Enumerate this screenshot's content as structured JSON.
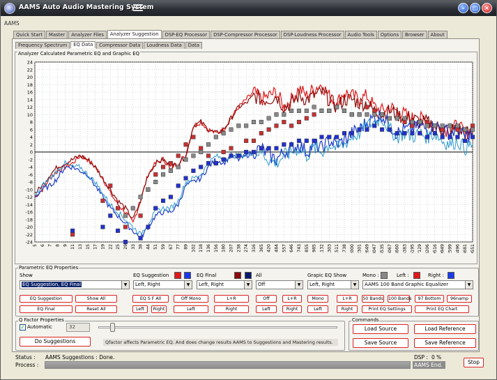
{
  "window": {
    "title": "AAMS Auto Audio Mastering System",
    "subtitle": "AAMS"
  },
  "tabs": [
    {
      "label": "Quick Start"
    },
    {
      "label": "Master"
    },
    {
      "label": "Analyzer Files"
    },
    {
      "label": "Analyzer Suggestion",
      "active": true
    },
    {
      "label": "DSP-EQ Processor"
    },
    {
      "label": "DSP-Compressor Processor"
    },
    {
      "label": "DSP-Loudness Processor"
    },
    {
      "label": "Audio Tools"
    },
    {
      "label": "Options"
    },
    {
      "label": "Browser"
    },
    {
      "label": "About"
    }
  ],
  "subtabs": [
    {
      "label": "Frequency Spectrum"
    },
    {
      "label": "EQ Data",
      "active": true
    },
    {
      "label": "Compressor Data"
    },
    {
      "label": "Loudness Data"
    },
    {
      "label": "Data"
    }
  ],
  "chart_data": {
    "type": "line",
    "title": "Analyzer Calculated Parametric EQ and Graphic EQ",
    "ylim": [
      -24,
      24
    ],
    "yticks": [
      24,
      22,
      20,
      18,
      16,
      14,
      12,
      10,
      8,
      6,
      4,
      2,
      0,
      -2,
      -4,
      -6,
      -8,
      -10,
      -12,
      -14,
      -16,
      -18,
      -20,
      -22,
      -24
    ],
    "categories": [
      "5",
      "6",
      "7",
      "8",
      "9",
      "11",
      "13",
      "15",
      "17",
      "19",
      "22",
      "25",
      "29",
      "33",
      "38",
      "44",
      "51",
      "59",
      "67",
      "77",
      "89",
      "102",
      "118",
      "136",
      "156",
      "180",
      "207",
      "238",
      "274",
      "316",
      "365",
      "420",
      "484",
      "557",
      "646",
      "743",
      "855",
      "985",
      "1132",
      "1303",
      "1511",
      "1738",
      "2000",
      "2301",
      "2649",
      "3047",
      "3535",
      "4067",
      "4660",
      "5383",
      "6195",
      "7129",
      "8206",
      "9516",
      "10949",
      "12599",
      "14496",
      "16681",
      "19551"
    ],
    "series": [
      {
        "color": "#e01818",
        "values": [
          -12,
          -10,
          -7,
          -5,
          -4,
          -3,
          -1,
          -2,
          -4,
          -7,
          -11,
          -14,
          -16,
          -19,
          -13,
          -6,
          -3,
          -2,
          -4,
          -3,
          -1,
          7,
          8,
          6,
          5,
          6,
          9,
          12,
          14,
          16,
          14,
          15,
          16,
          12,
          14,
          17,
          15,
          17,
          18,
          15,
          13,
          16,
          15,
          14,
          15,
          12,
          11,
          12,
          11,
          10,
          9,
          9,
          8,
          7,
          6,
          6,
          7,
          5,
          6
        ]
      },
      {
        "color": "#8b0a0a",
        "values": [
          -11,
          -9,
          -6,
          -4,
          -3,
          -2,
          -1,
          -2,
          -4,
          -7,
          -10,
          -13,
          -15,
          -18,
          -13,
          -6,
          -3,
          -2,
          -4,
          -3,
          -1,
          7,
          8,
          6,
          5,
          6,
          9,
          12,
          13,
          15,
          14,
          14,
          15,
          12,
          13,
          15,
          14,
          15,
          16,
          14,
          12,
          14,
          14,
          13,
          13,
          11,
          10,
          11,
          10,
          9,
          9,
          8,
          8,
          7,
          6,
          6,
          6,
          5,
          5
        ]
      },
      {
        "color": "#1a3ac8",
        "values": [
          -12,
          -10,
          -9,
          -7,
          -4,
          -4,
          -5,
          -6,
          -9,
          -12,
          -15,
          -17,
          -19,
          -21,
          -23,
          -20,
          -17,
          -16,
          -16,
          -14,
          -9,
          -8,
          -7,
          -4,
          -2,
          -3,
          -1,
          -2,
          -1,
          0,
          1,
          -1,
          -2,
          0,
          1,
          2,
          0,
          2,
          1,
          3,
          2,
          3,
          5,
          6,
          8,
          9,
          10,
          7,
          5,
          6,
          6,
          7,
          6,
          7,
          6,
          5,
          6,
          4,
          5
        ]
      },
      {
        "color": "#1a8ec8",
        "values": [
          -12,
          -9,
          -7,
          -5,
          -3,
          -4,
          -4,
          -6,
          -8,
          -11,
          -14,
          -16,
          -18,
          -20,
          -22,
          -19,
          -16,
          -15,
          -15,
          -13,
          -8,
          -7,
          -6,
          -3,
          -1,
          -2,
          -1,
          -1,
          -1,
          0,
          0,
          -2,
          -3,
          -1,
          0,
          1,
          -1,
          1,
          0,
          2,
          1,
          2,
          4,
          5,
          7,
          8,
          9,
          6,
          4,
          5,
          4,
          5,
          4,
          5,
          3,
          2,
          3,
          1,
          2
        ]
      }
    ],
    "markers": [
      {
        "name": "EQ Suggestion L",
        "color": "#c83030",
        "values": [
          null,
          null,
          null,
          null,
          null,
          -22,
          null,
          null,
          null,
          -13,
          -9,
          -15,
          -20,
          null,
          -17,
          -10,
          -6,
          -4,
          -3,
          -1,
          2,
          4,
          1,
          -1,
          -3,
          0,
          1,
          -1,
          3,
          3,
          5,
          6,
          7,
          8,
          7,
          8,
          9,
          10,
          11,
          11,
          12,
          11,
          10,
          10,
          12,
          11,
          10,
          9,
          9,
          8,
          7,
          8,
          8,
          7,
          6,
          7,
          6,
          6,
          7
        ]
      },
      {
        "name": "EQ Suggestion R",
        "color": "#2030d0",
        "values": [
          null,
          null,
          null,
          null,
          null,
          -21,
          null,
          null,
          null,
          -20,
          -17,
          -21,
          -24,
          null,
          -23,
          -20,
          -15,
          -13,
          -12,
          -9,
          -7,
          -5,
          -4,
          -3,
          -3,
          -2,
          -1,
          -1,
          0,
          0,
          1,
          1,
          1,
          2,
          2,
          3,
          3,
          3,
          4,
          4,
          4,
          5,
          5,
          6,
          6,
          7,
          6,
          6,
          5,
          5,
          5,
          5,
          4,
          5,
          4,
          4,
          4,
          3,
          4
        ]
      },
      {
        "name": "Graphic EQ",
        "color": "#888888",
        "values": [
          null,
          null,
          null,
          null,
          null,
          null,
          null,
          null,
          null,
          null,
          null,
          null,
          -17,
          -15,
          -12,
          -10,
          -8,
          -6,
          -5,
          -4,
          -2,
          -1,
          0,
          2,
          4,
          5,
          6,
          7,
          7,
          8,
          8,
          9,
          10,
          10,
          11,
          11,
          11,
          12,
          11,
          11,
          12,
          11,
          10,
          10,
          10,
          10,
          10,
          9,
          9,
          9,
          8,
          8,
          7,
          7,
          7,
          7,
          7,
          6,
          6
        ]
      }
    ],
    "grid": true
  },
  "parametric": {
    "group_label": "Parametric EQ Properties",
    "show_label": "Show",
    "show_value": "EQ Suggestion, EQ Final",
    "eq_suggestion_label": "EQ Suggestion",
    "eq_suggestion_value": "Left, Right",
    "eq_final_label": "EQ Final",
    "eq_final_value": "Left, Right",
    "all_label": "All",
    "all_value": "Off",
    "graphic_label": "Grapic EQ Show",
    "graphic_value": "Left, Right",
    "mono_label": "Mono :",
    "left_label": "Left :",
    "right_label": "Right :",
    "graphic_eq_value": "AAMS 100 Band Graphic Equalizer",
    "colors": {
      "eq_sugg_left": "#e01818",
      "eq_sugg_right": "#1a3ae8",
      "eq_final_left": "#8b0a0a",
      "eq_final_right": "#0a1a6a",
      "mono": "#888888",
      "left": "#e01818",
      "right": "#1a3ae8"
    },
    "buttons_row1": [
      "EQ Suggestion",
      "Show All",
      "EQ S F All",
      "Off Mono",
      "L+R",
      "Off",
      "L+R",
      "Mono",
      "L+R",
      "50 Bands",
      "100 Bands",
      "97 Bottom",
      "96namp"
    ],
    "buttons_row2": [
      "EQ Final",
      "Reset All",
      "Left",
      "Right",
      "Left",
      "Right",
      "Left",
      "Right",
      "Left",
      "Right",
      "Print EQ Settings",
      "Print EQ Chart"
    ]
  },
  "qfactor": {
    "group_label": "Q Factor Properties",
    "automatic_label": "Automatic",
    "value": "32",
    "slider_level": 0.05,
    "do_suggestions": "Do Suggestions",
    "hint": "Qfactor affects Parametric EQ. And does change results AAMS to Suggestions and Mastering results."
  },
  "commands": {
    "group_label": "Commands",
    "load_source": "Load Source",
    "load_reference": "Load Reference",
    "save_source": "Save Source",
    "save_reference": "Save Reference"
  },
  "status": {
    "status_label": "Status :",
    "status_value": "AAMS Suggestions : Done.",
    "process_label": "Process :",
    "dsp_label": "DSP :",
    "dsp_value": "0 %",
    "aams_end": "AAMS End.",
    "stop": "Stop"
  }
}
